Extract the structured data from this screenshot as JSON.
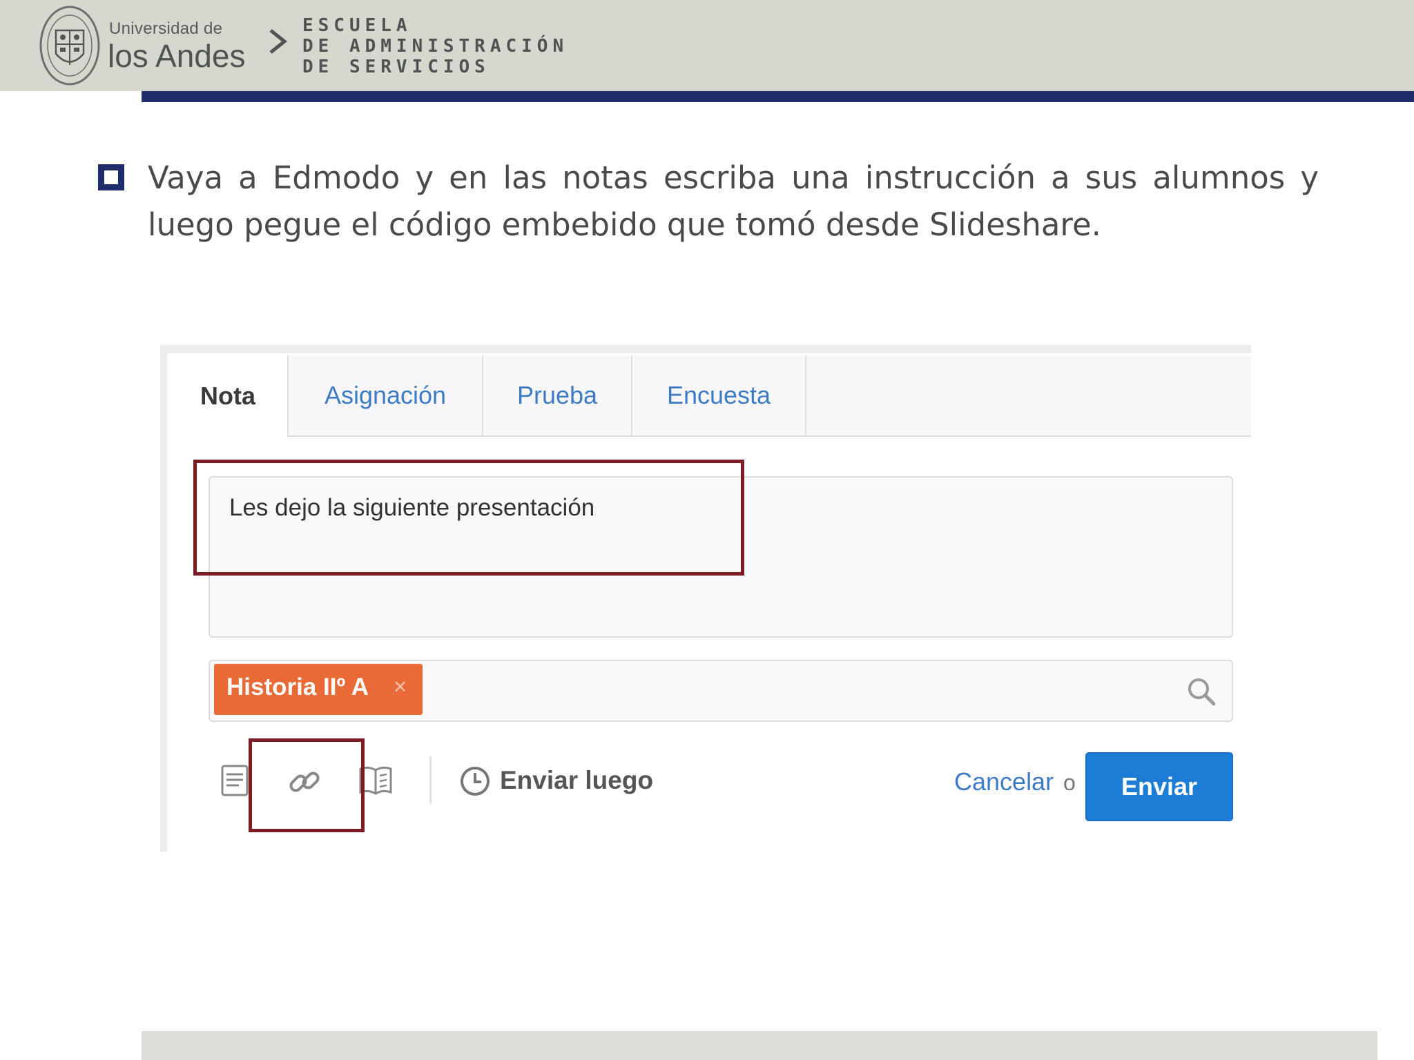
{
  "header": {
    "university_small": "Universidad de",
    "university_big": "los Andes",
    "school_lines": [
      "ESCUELA",
      "DE ADMINISTRACIÓN",
      "DE SERVICIOS"
    ]
  },
  "bullet_text": "Vaya a Edmodo y en las notas escriba una instrucción a sus alumnos y luego pegue el código embebido que tomó desde Slideshare.",
  "edmodo": {
    "tabs": [
      {
        "label": "Nota",
        "active": true
      },
      {
        "label": "Asignación",
        "active": false
      },
      {
        "label": "Prueba",
        "active": false
      },
      {
        "label": "Encuesta",
        "active": false
      }
    ],
    "note_text": "Les dejo la siguiente presentación",
    "recipient_tag": "Historia IIº A",
    "tag_remove": "×",
    "send_later": "Enviar luego",
    "cancel": "Cancelar",
    "or": "o",
    "send": "Enviar",
    "icons": [
      "note-icon",
      "link-icon",
      "library-icon",
      "clock-icon",
      "search-icon"
    ]
  },
  "colors": {
    "brand_navy": "#1f2e6b",
    "tag_orange": "#e96a37",
    "send_blue": "#1d7cd5",
    "highlight_red": "#7b1c24"
  }
}
